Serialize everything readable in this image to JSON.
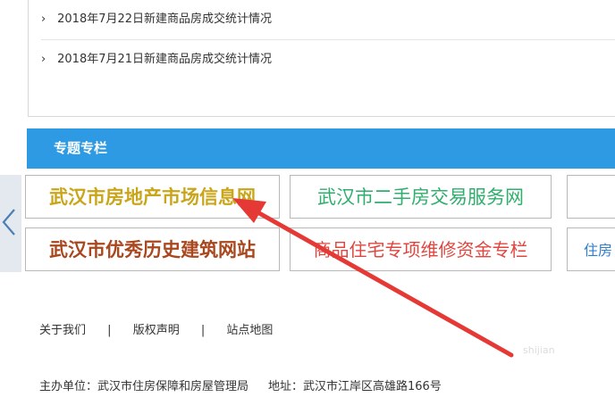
{
  "news": [
    {
      "chevron": "›",
      "title": "2018年7月22日新建商品房成交统计情况"
    },
    {
      "chevron": "›",
      "title": "2018年7月21日新建商品房成交统计情况"
    }
  ],
  "section": {
    "title": "专题专栏"
  },
  "tiles": [
    {
      "label": "武汉市房地产市场信息网"
    },
    {
      "label": "武汉市二手房交易服务网"
    },
    {
      "label": ""
    },
    {
      "label": "武汉市优秀历史建筑网站"
    },
    {
      "label": "商品住宅专项维修资金专栏"
    },
    {
      "label": "住房"
    }
  ],
  "footer": {
    "links": [
      "关于我们",
      "版权声明",
      "站点地图"
    ],
    "separator": "|",
    "host": "主办单位：武汉市住房保障和房屋管理局",
    "address": "地址：武汉市江岸区高雄路166号"
  },
  "watermark": "shijian",
  "colors": {
    "header": "#2e9ae3",
    "annotation_arrow": "#e53935"
  }
}
